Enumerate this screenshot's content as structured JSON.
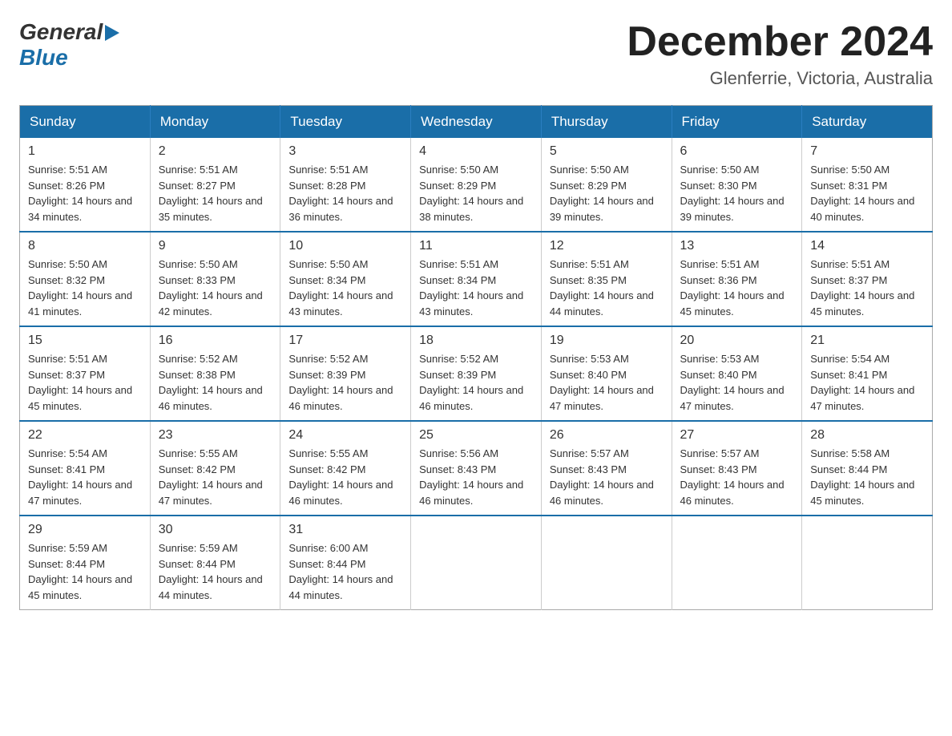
{
  "logo": {
    "general": "General",
    "arrow": "▶",
    "blue": "Blue"
  },
  "title": {
    "month": "December 2024",
    "location": "Glenferrie, Victoria, Australia"
  },
  "headers": [
    "Sunday",
    "Monday",
    "Tuesday",
    "Wednesday",
    "Thursday",
    "Friday",
    "Saturday"
  ],
  "weeks": [
    [
      {
        "day": "1",
        "sunrise": "5:51 AM",
        "sunset": "8:26 PM",
        "daylight": "14 hours and 34 minutes."
      },
      {
        "day": "2",
        "sunrise": "5:51 AM",
        "sunset": "8:27 PM",
        "daylight": "14 hours and 35 minutes."
      },
      {
        "day": "3",
        "sunrise": "5:51 AM",
        "sunset": "8:28 PM",
        "daylight": "14 hours and 36 minutes."
      },
      {
        "day": "4",
        "sunrise": "5:50 AM",
        "sunset": "8:29 PM",
        "daylight": "14 hours and 38 minutes."
      },
      {
        "day": "5",
        "sunrise": "5:50 AM",
        "sunset": "8:29 PM",
        "daylight": "14 hours and 39 minutes."
      },
      {
        "day": "6",
        "sunrise": "5:50 AM",
        "sunset": "8:30 PM",
        "daylight": "14 hours and 39 minutes."
      },
      {
        "day": "7",
        "sunrise": "5:50 AM",
        "sunset": "8:31 PM",
        "daylight": "14 hours and 40 minutes."
      }
    ],
    [
      {
        "day": "8",
        "sunrise": "5:50 AM",
        "sunset": "8:32 PM",
        "daylight": "14 hours and 41 minutes."
      },
      {
        "day": "9",
        "sunrise": "5:50 AM",
        "sunset": "8:33 PM",
        "daylight": "14 hours and 42 minutes."
      },
      {
        "day": "10",
        "sunrise": "5:50 AM",
        "sunset": "8:34 PM",
        "daylight": "14 hours and 43 minutes."
      },
      {
        "day": "11",
        "sunrise": "5:51 AM",
        "sunset": "8:34 PM",
        "daylight": "14 hours and 43 minutes."
      },
      {
        "day": "12",
        "sunrise": "5:51 AM",
        "sunset": "8:35 PM",
        "daylight": "14 hours and 44 minutes."
      },
      {
        "day": "13",
        "sunrise": "5:51 AM",
        "sunset": "8:36 PM",
        "daylight": "14 hours and 45 minutes."
      },
      {
        "day": "14",
        "sunrise": "5:51 AM",
        "sunset": "8:37 PM",
        "daylight": "14 hours and 45 minutes."
      }
    ],
    [
      {
        "day": "15",
        "sunrise": "5:51 AM",
        "sunset": "8:37 PM",
        "daylight": "14 hours and 45 minutes."
      },
      {
        "day": "16",
        "sunrise": "5:52 AM",
        "sunset": "8:38 PM",
        "daylight": "14 hours and 46 minutes."
      },
      {
        "day": "17",
        "sunrise": "5:52 AM",
        "sunset": "8:39 PM",
        "daylight": "14 hours and 46 minutes."
      },
      {
        "day": "18",
        "sunrise": "5:52 AM",
        "sunset": "8:39 PM",
        "daylight": "14 hours and 46 minutes."
      },
      {
        "day": "19",
        "sunrise": "5:53 AM",
        "sunset": "8:40 PM",
        "daylight": "14 hours and 47 minutes."
      },
      {
        "day": "20",
        "sunrise": "5:53 AM",
        "sunset": "8:40 PM",
        "daylight": "14 hours and 47 minutes."
      },
      {
        "day": "21",
        "sunrise": "5:54 AM",
        "sunset": "8:41 PM",
        "daylight": "14 hours and 47 minutes."
      }
    ],
    [
      {
        "day": "22",
        "sunrise": "5:54 AM",
        "sunset": "8:41 PM",
        "daylight": "14 hours and 47 minutes."
      },
      {
        "day": "23",
        "sunrise": "5:55 AM",
        "sunset": "8:42 PM",
        "daylight": "14 hours and 47 minutes."
      },
      {
        "day": "24",
        "sunrise": "5:55 AM",
        "sunset": "8:42 PM",
        "daylight": "14 hours and 46 minutes."
      },
      {
        "day": "25",
        "sunrise": "5:56 AM",
        "sunset": "8:43 PM",
        "daylight": "14 hours and 46 minutes."
      },
      {
        "day": "26",
        "sunrise": "5:57 AM",
        "sunset": "8:43 PM",
        "daylight": "14 hours and 46 minutes."
      },
      {
        "day": "27",
        "sunrise": "5:57 AM",
        "sunset": "8:43 PM",
        "daylight": "14 hours and 46 minutes."
      },
      {
        "day": "28",
        "sunrise": "5:58 AM",
        "sunset": "8:44 PM",
        "daylight": "14 hours and 45 minutes."
      }
    ],
    [
      {
        "day": "29",
        "sunrise": "5:59 AM",
        "sunset": "8:44 PM",
        "daylight": "14 hours and 45 minutes."
      },
      {
        "day": "30",
        "sunrise": "5:59 AM",
        "sunset": "8:44 PM",
        "daylight": "14 hours and 44 minutes."
      },
      {
        "day": "31",
        "sunrise": "6:00 AM",
        "sunset": "8:44 PM",
        "daylight": "14 hours and 44 minutes."
      },
      null,
      null,
      null,
      null
    ]
  ]
}
